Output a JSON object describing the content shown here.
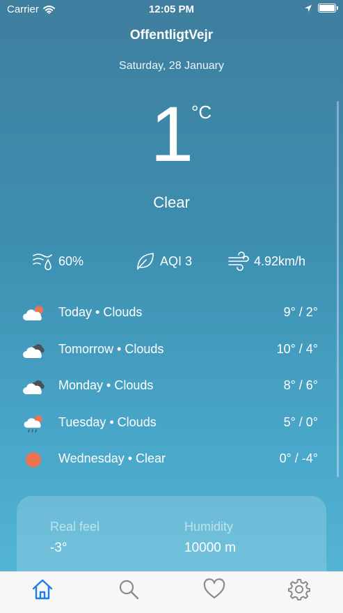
{
  "status_bar": {
    "carrier": "Carrier",
    "time": "12:05 PM",
    "battery_level": 1.0
  },
  "app": {
    "title": "OffentligtVejr"
  },
  "current": {
    "date": "Saturday, 28 January",
    "temperature": "1",
    "unit": "°C",
    "condition": "Clear"
  },
  "stats": {
    "humidity": "60%",
    "aqi": "AQI 3",
    "wind": "4.92km/h"
  },
  "forecast": [
    {
      "label": "Today • Clouds",
      "range": "9° / 2°",
      "icon": "cloud-sun-icon"
    },
    {
      "label": "Tomorrow • Clouds",
      "range": "10° / 4°",
      "icon": "cloudy-icon"
    },
    {
      "label": "Monday • Clouds",
      "range": "8° / 6°",
      "icon": "cloudy-icon"
    },
    {
      "label": "Tuesday • Clouds",
      "range": "5° / 0°",
      "icon": "rain-sun-icon"
    },
    {
      "label": "Wednesday • Clear",
      "range": "0° / -4°",
      "icon": "sun-icon"
    }
  ],
  "details": {
    "real_feel_label": "Real feel",
    "real_feel_value": "-3°",
    "humidity_label": "Humidity",
    "humidity_value": "10000 m"
  },
  "tabs": [
    {
      "name": "home",
      "icon": "home-icon",
      "active": true
    },
    {
      "name": "search",
      "icon": "search-icon",
      "active": false
    },
    {
      "name": "favorites",
      "icon": "heart-icon",
      "active": false
    },
    {
      "name": "settings",
      "icon": "gear-icon",
      "active": false
    }
  ],
  "colors": {
    "accent": "#1e7cf2",
    "sun": "#ec7453",
    "tab_inactive": "#8a8a8e"
  }
}
